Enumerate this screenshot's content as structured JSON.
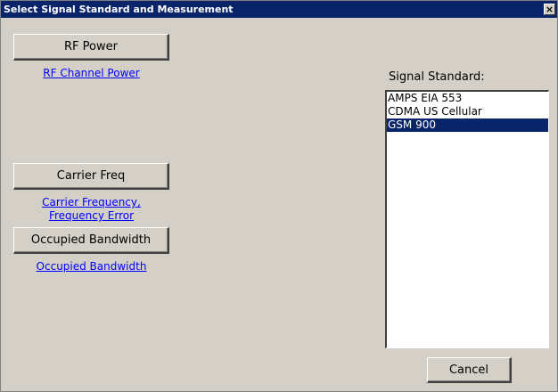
{
  "window": {
    "title": "Select Signal Standard and Measurement",
    "close_glyph": "×"
  },
  "measurements": [
    {
      "button_label": "RF Power",
      "link_lines": [
        "RF Channel Power"
      ]
    },
    {
      "button_label": "Carrier Freq",
      "link_lines": [
        "Carrier Frequency,",
        "Frequency Error"
      ]
    },
    {
      "button_label": "Occupied Bandwidth",
      "link_lines": [
        "Occupied Bandwidth"
      ]
    }
  ],
  "signal_standard": {
    "label": "Signal Standard:",
    "items": [
      "AMPS EIA 553",
      "CDMA US Cellular",
      "GSM 900"
    ],
    "selected_index": 2
  },
  "cancel_label": "Cancel",
  "colors": {
    "title_bar": "#0a246a",
    "face": "#d4d0c8",
    "link": "#0000ff",
    "selection": "#0a246a"
  }
}
